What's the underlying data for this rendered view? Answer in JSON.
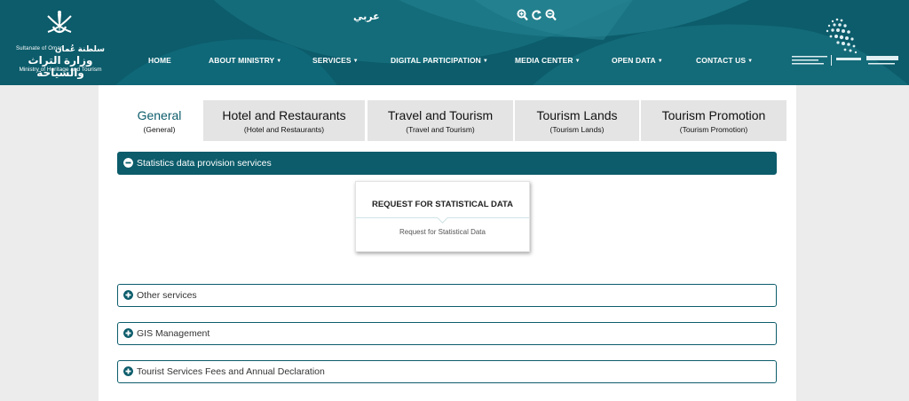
{
  "header": {
    "logo": {
      "sultanate_en": "Sultanate of Oman",
      "sultanate_ar": "سلطنة عُمان",
      "ministry_ar": "وزارة التراث والسياحة",
      "ministry_en": "Ministry of Heritage and Tourism"
    },
    "language_toggle": "عربي",
    "zoom_icons": [
      "zoom-in-icon",
      "reset-icon",
      "zoom-out-icon"
    ],
    "nav": [
      {
        "label": "HOME",
        "dropdown": false
      },
      {
        "label": "ABOUT MINISTRY",
        "dropdown": true
      },
      {
        "label": "SERVICES",
        "dropdown": true
      },
      {
        "label": "DIGITAL PARTICIPATION",
        "dropdown": true
      },
      {
        "label": "MEDIA CENTER",
        "dropdown": true
      },
      {
        "label": "OPEN DATA",
        "dropdown": true
      },
      {
        "label": "CONTACT US",
        "dropdown": true
      }
    ],
    "caret": "▼"
  },
  "tabs": [
    {
      "label": "General",
      "sub": "(General)",
      "active": true
    },
    {
      "label": "Hotel and Restaurants",
      "sub": "(Hotel and Restaurants)",
      "active": false
    },
    {
      "label": "Travel and Tourism",
      "sub": "(Travel and Tourism)",
      "active": false
    },
    {
      "label": "Tourism Lands",
      "sub": "(Tourism Lands)",
      "active": false
    },
    {
      "label": "Tourism Promotion",
      "sub": "(Tourism Promotion)",
      "active": false
    }
  ],
  "sections": [
    {
      "label": "Statistics data provision services",
      "open": true
    },
    {
      "label": "Other services",
      "open": false
    },
    {
      "label": "GIS Management",
      "open": false
    },
    {
      "label": "Tourist Services Fees and Annual Declaration",
      "open": false
    }
  ],
  "service_card": {
    "title": "REQUEST FOR STATISTICAL DATA",
    "subtitle": "Request for Statistical Data"
  },
  "colors": {
    "brand": "#0c5c6b",
    "page_bg": "#ececec",
    "inactive_tab": "#e4e4e4"
  }
}
